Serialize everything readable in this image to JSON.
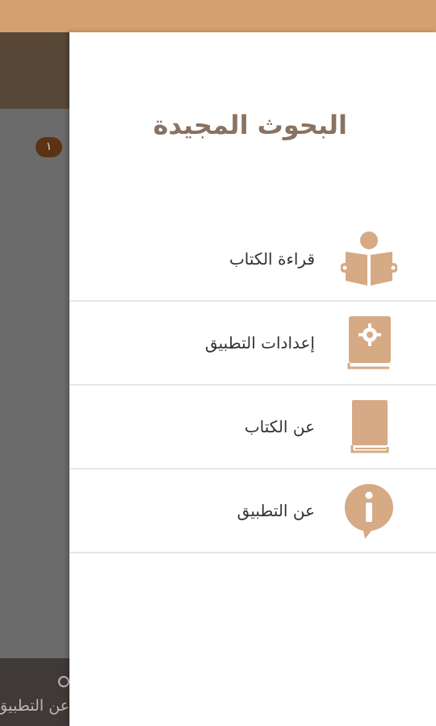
{
  "colors": {
    "status_bar": "#d5a070",
    "accent": "#d5aa85",
    "title": "#8a7260",
    "overlay": "#6b6b6b",
    "background_header": "#574838",
    "badge": "#5b3314"
  },
  "background": {
    "badge_count": "١",
    "bottom_label": "عن التطبيق"
  },
  "drawer": {
    "title": "البحوث المجيدة",
    "items": [
      {
        "label": "قراءة الكتاب",
        "icon": "reading-person-icon"
      },
      {
        "label": "إعدادات التطبيق",
        "icon": "settings-book-icon"
      },
      {
        "label": "عن الكتاب",
        "icon": "book-icon"
      },
      {
        "label": "عن التطبيق",
        "icon": "info-bubble-icon"
      }
    ]
  }
}
